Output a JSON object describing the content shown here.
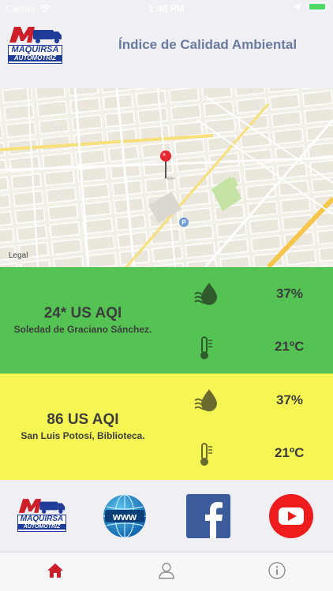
{
  "status_bar": {
    "carrier": "Carrier",
    "time": "1:48 PM"
  },
  "header": {
    "logo_text": "MAQUIRSA",
    "logo_subtext": "AUTOMOTRIZ",
    "title": "Índice de Calidad Ambiental"
  },
  "map": {
    "legal_label": "Legal"
  },
  "stations": [
    {
      "aqi": "24* US AQI",
      "name": "Soledad de Graciano Sánchez.",
      "humidity": "37%",
      "temperature": "21ºC",
      "color": "#54c353"
    },
    {
      "aqi": "86 US AQI",
      "name": "San Luis Potosí, Biblioteca.",
      "humidity": "37%",
      "temperature": "21ºC",
      "color": "#f5f553"
    }
  ],
  "links": [
    {
      "icon": "maquirsa-logo-icon"
    },
    {
      "icon": "www-globe-icon",
      "label": "www"
    },
    {
      "icon": "facebook-icon"
    },
    {
      "icon": "youtube-icon"
    }
  ],
  "tabs": [
    {
      "icon": "home-icon",
      "active": true
    },
    {
      "icon": "profile-icon",
      "active": false
    },
    {
      "icon": "info-icon",
      "active": false
    }
  ],
  "colors": {
    "accent": "#cc1f2a",
    "brand_blue": "#1f3c98",
    "title_gray": "#6b7aa0"
  }
}
